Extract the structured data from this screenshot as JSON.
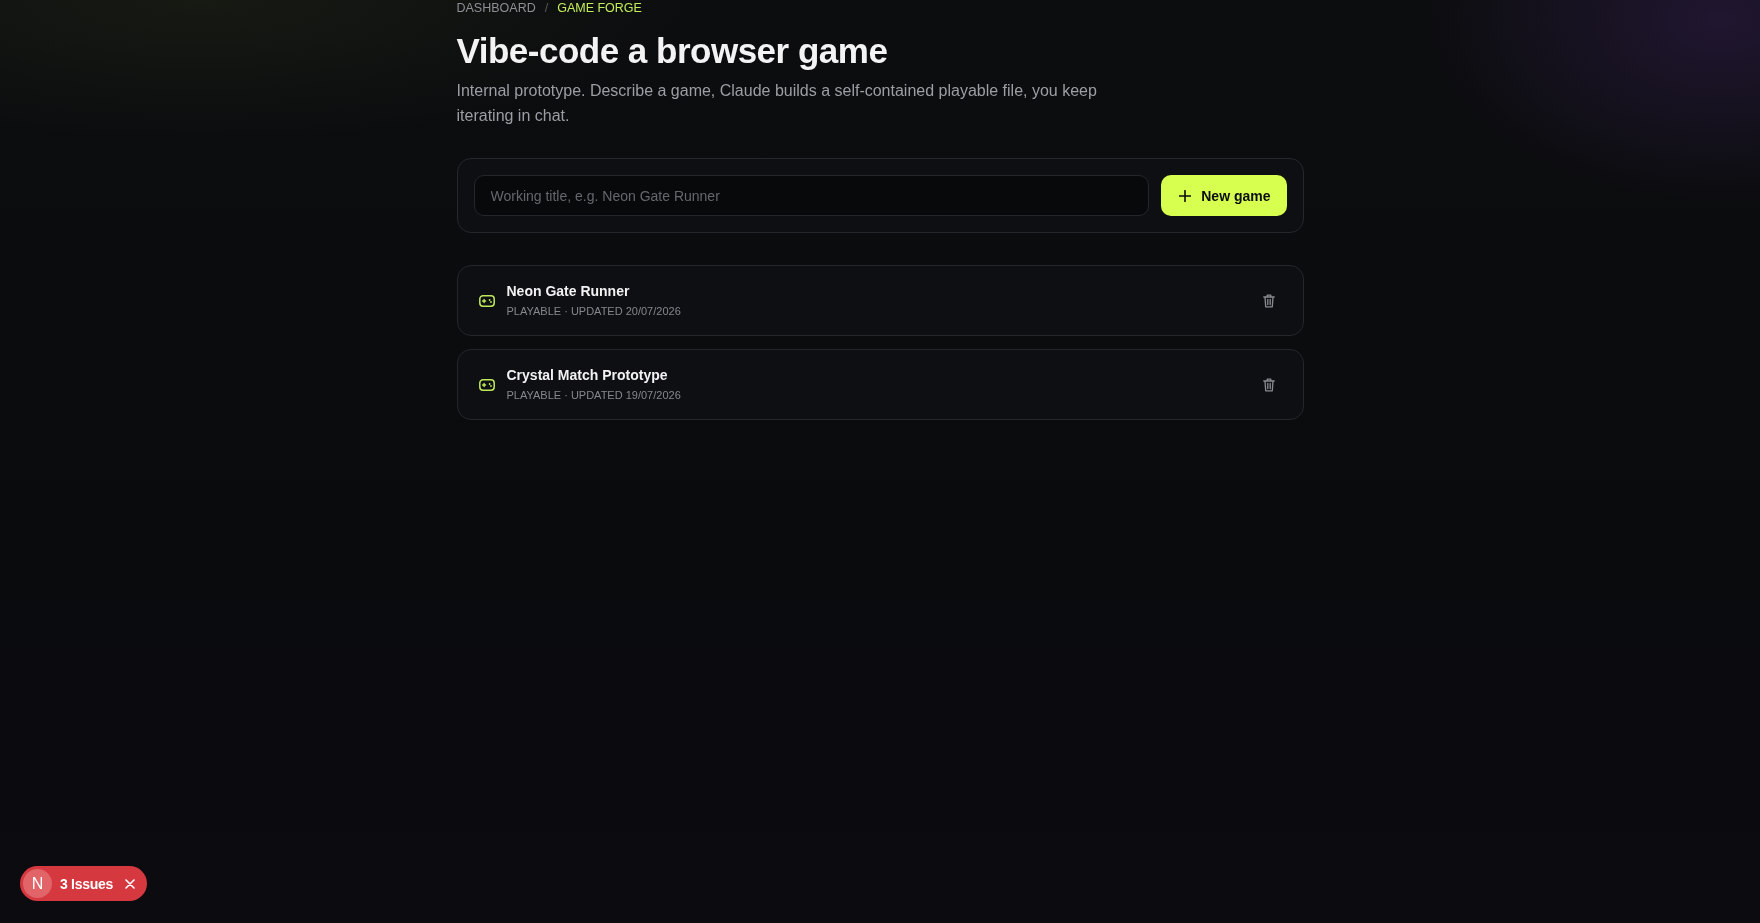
{
  "breadcrumb": {
    "separator": "/",
    "items": [
      {
        "label": "DASHBOARD",
        "current": false
      },
      {
        "label": "GAME FORGE",
        "current": true
      }
    ]
  },
  "title": "Vibe-code a browser game",
  "subtitle": "Internal prototype. Describe a game, Claude builds a self-contained playable file, you keep iterating in chat.",
  "new_game_form": {
    "placeholder": "Working title, e.g. Neon Gate Runner",
    "button": "New game"
  },
  "games": [
    {
      "title": "Neon Gate Runner",
      "meta": "PLAYABLE · UPDATED 20/07/2026"
    },
    {
      "title": "Crystal Match Prototype",
      "meta": "PLAYABLE · UPDATED 19/07/2026"
    }
  ],
  "issues_badge": {
    "logo_letter": "N",
    "label": "3 Issues"
  }
}
